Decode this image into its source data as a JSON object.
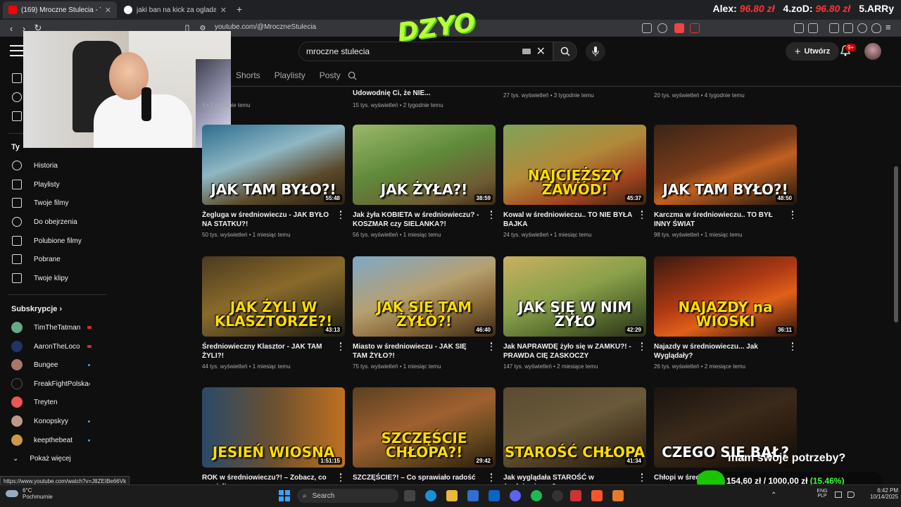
{
  "browser": {
    "tabs": [
      {
        "label": "(169) Mroczne Stulecia - YouTube",
        "close": "✕"
      },
      {
        "label": "jaki ban na kick za ogladanie porno",
        "close": "✕"
      }
    ],
    "new_tab": "+",
    "url": "youtube.com/@MroczneStulecia"
  },
  "stream_overlay": {
    "logo": "DZYO",
    "leaderboard": [
      {
        "label": "Alex:",
        "value": "96.80 zł"
      },
      {
        "label": "4.zoD:",
        "value": "96.80 zł"
      },
      {
        "label": "5.ARRy",
        "value": ""
      }
    ],
    "donation_question": "mam swoje potrzeby?",
    "donation_progress": "154,60 zł / 1000,00 zł",
    "donation_percent": "(15.46%)",
    "donation_fraction": 0.1546
  },
  "youtube": {
    "search_value": "mroczne stulecia",
    "create_label": "Utwórz",
    "notif_count": "9+",
    "channel_tabs": [
      "Shorts",
      "Playlisty",
      "Posty"
    ]
  },
  "sidebar": {
    "you_title": "Ty",
    "you_items": [
      "Historia",
      "Playlisty",
      "Twoje filmy",
      "Do obejrzenia",
      "Polubione filmy",
      "Pobrane",
      "Twoje klipy"
    ],
    "subs_title": "Subskrypcje",
    "subscriptions": [
      {
        "name": "TimTheTatman",
        "status": "live"
      },
      {
        "name": "AaronTheLoco",
        "status": "live"
      },
      {
        "name": "Bungee",
        "status": "new"
      },
      {
        "name": "FreakFightPolska",
        "status": "new"
      },
      {
        "name": "Treyten",
        "status": ""
      },
      {
        "name": "Konopskyy",
        "status": "new"
      },
      {
        "name": "keepthebeat",
        "status": "new"
      }
    ],
    "show_more": "Pokaż więcej"
  },
  "top_row_partial": [
    {
      "title": "",
      "meta": "2 tygodnie temu",
      "prefix": "ń"
    },
    {
      "title": "Udowodnię Ci, że NIE...",
      "meta": "15 tys. wyświetleń • 2 tygodnie temu"
    },
    {
      "title": "",
      "meta": "27 tys. wyświetleń • 3 tygodnie temu"
    },
    {
      "title": "",
      "meta": "20 tys. wyświetleń • 4 tygodnie temu"
    }
  ],
  "videos": [
    {
      "thumb_text": "JAK TAM BYŁO?!",
      "duration": "55:48",
      "title": "Żegluga w średniowieczu - JAK BYŁO NA STATKU?!",
      "meta": "50 tys. wyświetleń • 1 miesiąc temu",
      "bg": "linear-gradient(160deg,#2c6d8e,#8fb7c4 40%,#5b4a2a 70%,#2b2012)"
    },
    {
      "thumb_text": "JAK ŻYŁA?!",
      "duration": "38:59",
      "title": "Jak żyła KOBIETA w średniowieczu? - KOSZMAR czy SIELANKA?!",
      "meta": "56 tys. wyświetleń • 1 miesiąc temu",
      "bg": "linear-gradient(160deg,#9cb86a,#5f8a3a 45%,#6e5a33 80%,#3b2c14)"
    },
    {
      "thumb_text": "NAJCIĘŻSZY ZAWÓD!",
      "duration": "45:37",
      "title": "Kowal w średniowieczu.. TO NIE BYŁA BAJKA",
      "meta": "24 tys. wyświetleń • 1 miesiąc temu",
      "bg": "linear-gradient(160deg,#7fa35a,#b08a3a 45%,#a0431e 75%,#3c2410)",
      "yellow": true
    },
    {
      "thumb_text": "JAK TAM BYŁO?!",
      "duration": "48:50",
      "title": "Karczma w średniowieczu.. TO BYŁ INNY ŚWIAT",
      "meta": "98 tys. wyświetleń • 1 miesiąc temu",
      "bg": "linear-gradient(160deg,#3a2418,#7a3c1a 45%,#c06020 60%,#1e140c)"
    },
    {
      "thumb_text": "JAK ŻYLI W KLASZTORZE?!",
      "duration": "43:13",
      "title": "Średniowieczny Klasztor - JAK TAM ŻYLI?!",
      "meta": "44 tys. wyświetleń • 1 miesiąc temu",
      "bg": "linear-gradient(160deg,#4a3a20,#8a6a2a 45%,#5a4a22 70%,#1e1a10)",
      "yellow": true
    },
    {
      "thumb_text": "JAK SIĘ TAM ŻYŁO?!",
      "duration": "46:40",
      "title": "Miasto w średniowieczu - JAK SIĘ TAM ŻYŁO?!",
      "meta": "75 tys. wyświetleń • 1 miesiąc temu",
      "bg": "linear-gradient(160deg,#7ea8c8,#b6a070 45%,#8a6a3a 70%,#3a2a18)",
      "yellow": true
    },
    {
      "thumb_text": "JAK SIĘ W NIM ŻYŁO",
      "duration": "42:29",
      "title": "Jak NAPRAWDĘ żyło się w ZAMKU?! - PRAWDA CIĘ ZASKOCZY",
      "meta": "147 tys. wyświetleń • 2 miesiące temu",
      "bg": "linear-gradient(160deg,#c8b060,#8aa04a 45%,#5a7030 70%,#2a3018)"
    },
    {
      "thumb_text": "NAJAZDY na WIOSKI",
      "duration": "36:11",
      "title": "Najazdy w średniowieczu... Jak Wyglądały?",
      "meta": "26 tys. wyświetleń • 2 miesiące temu",
      "bg": "linear-gradient(160deg,#3a1a10,#b03a14 45%,#e0601a 65%,#2a120a)",
      "yellow": true
    },
    {
      "thumb_text": "JESIEŃ   WIOSNA",
      "duration": "1:51:15",
      "title": "ROK w średniowieczu?! – Zobacz, co musieli",
      "meta": "",
      "bg": "linear-gradient(90deg,#2a4a6a,#6a5030 50%,#c07020)",
      "yellow": true
    },
    {
      "thumb_text": "SZCZĘŚCIE CHŁOPA?!",
      "duration": "29:42",
      "title": "SZCZĘŚCIE?! – Co sprawiało radość w",
      "meta": "",
      "bg": "linear-gradient(160deg,#5a4020,#a06030 45%,#6a4a20 70%,#2a1c0c)",
      "yellow": true
    },
    {
      "thumb_text": "STAROŚĆ CHŁOPA",
      "duration": "41:34",
      "title": "Jak wyglądała STAROŚĆ w średniowieczu? -",
      "meta": "",
      "bg": "linear-gradient(160deg,#5a4a30,#6a5a3a 45%,#4a3a22 70%,#20180c)",
      "yellow": true
    },
    {
      "thumb_text": "CZEGO SIĘ BAŁ?",
      "duration": "",
      "title": "Chłopi w średniowieczu... ZOBACZ",
      "meta": "",
      "bg": "linear-gradient(160deg,#1a1410,#3a2a1a 45%,#2a1c10 70%,#0e0a06)"
    }
  ],
  "status_url": "https://www.youtube.com/watch?v=J8ZEIBe66Vk",
  "taskbar": {
    "weather_temp": "6°C",
    "weather_desc": "Pochmurnie",
    "search_label": "Search",
    "lang_top": "ENG",
    "lang_bottom": "PLP",
    "time": "6:42 PM",
    "date": "10/14/2025"
  }
}
